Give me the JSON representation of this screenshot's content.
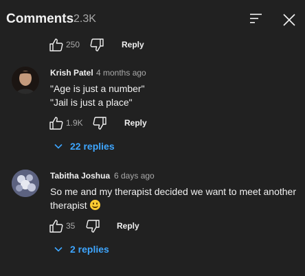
{
  "header": {
    "title": "Comments",
    "count": "2.3K",
    "sort_icon": "sort-icon",
    "close_icon": "close-icon"
  },
  "top_comment_actions": {
    "like_count": "250",
    "reply_label": "Reply"
  },
  "comments": [
    {
      "author": "Krish Patel",
      "time": "4 months ago",
      "lines": [
        "\"Age is just a number\"",
        "\"Jail is just a place\""
      ],
      "like_count": "1.9K",
      "reply_label": "Reply",
      "replies_label": "22 replies"
    },
    {
      "author": "Tabitha Joshua",
      "time": "6 days ago",
      "lines": [
        "So me and my therapist decided we want to meet another",
        "therapist"
      ],
      "emoji": "grinning-face-emoji",
      "like_count": "35",
      "reply_label": "Reply",
      "replies_label": "2 replies"
    }
  ],
  "colors": {
    "background": "#212121",
    "text": "#f1f1f1",
    "secondary": "#aaaaaa",
    "link": "#3ea6ff"
  }
}
